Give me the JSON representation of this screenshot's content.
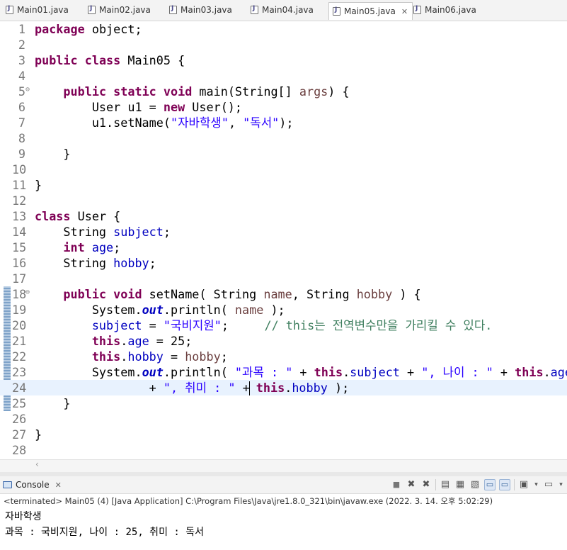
{
  "tabs": [
    {
      "label": "Main01.java",
      "active": false
    },
    {
      "label": "Main02.java",
      "active": false
    },
    {
      "label": "Main03.java",
      "active": false
    },
    {
      "label": "Main04.java",
      "active": false
    },
    {
      "label": "Main05.java",
      "active": true
    },
    {
      "label": "Main06.java",
      "active": false
    }
  ],
  "editor": {
    "line_numbers": [
      "1",
      "2",
      "3",
      "4",
      "5",
      "6",
      "7",
      "8",
      "9",
      "10",
      "11",
      "12",
      "13",
      "14",
      "15",
      "16",
      "17",
      "18",
      "19",
      "20",
      "21",
      "22",
      "23",
      "24",
      "25",
      "26",
      "27",
      "28"
    ],
    "current_line": "24",
    "code": {
      "l1_kw": "package",
      "l1_rest": " object;",
      "l3_kw1": "public",
      "l3_kw2": "class",
      "l3_rest": " Main05 {",
      "l5_ind": "    ",
      "l5_kw1": "public",
      "l5_kw2": "static",
      "l5_kw3": "void",
      "l5_rest": " main(String[] ",
      "l5_var": "args",
      "l5_end": ") {",
      "l6_pre": "        User u1 = ",
      "l6_kw": "new",
      "l6_rest": " User();",
      "l7_pre": "        u1.setName(",
      "l7_s1": "\"자바학생\"",
      "l7_mid": ", ",
      "l7_s2": "\"독서\"",
      "l7_end": ");",
      "l9": "    }",
      "l11": "}",
      "l13_kw": "class",
      "l13_rest": " User {",
      "l14_pre": "    String ",
      "l14_fld": "subject",
      "l14_end": ";",
      "l15_ind": "    ",
      "l15_kw": "int",
      "l15_sp": " ",
      "l15_fld": "age",
      "l15_end": ";",
      "l16_pre": "    String ",
      "l16_fld": "hobby",
      "l16_end": ";",
      "l18_ind": "    ",
      "l18_kw1": "public",
      "l18_kw2": "void",
      "l18_mid": " setName( String ",
      "l18_v1": "name",
      "l18_mid2": ", String ",
      "l18_v2": "hobby",
      "l18_end": " ) {",
      "l19_pre": "        System.",
      "l19_out": "out",
      "l19_mid": ".println( ",
      "l19_var": "name",
      "l19_end": " );",
      "l20_ind": "        ",
      "l20_fld": "subject",
      "l20_eq": " = ",
      "l20_str": "\"국비지원\"",
      "l20_semi": ";     ",
      "l20_cmt": "// this는 전역변수만을 가리킬 수 있다.",
      "l21_ind": "        ",
      "l21_kw": "this",
      "l21_dot": ".",
      "l21_fld": "age",
      "l21_end": " = 25;",
      "l22_ind": "        ",
      "l22_kw": "this",
      "l22_dot": ".",
      "l22_fld": "hobby",
      "l22_eq": " = ",
      "l22_var": "hobby",
      "l22_end": ";",
      "l23_pre": "        System.",
      "l23_out": "out",
      "l23_mid": ".println( ",
      "l23_s1": "\"과목 : \"",
      "l23_p1": " + ",
      "l23_kw1": "this",
      "l23_d1": ".",
      "l23_f1": "subject",
      "l23_p2": " + ",
      "l23_s2": "\", 나이 : \"",
      "l23_p3": " + ",
      "l23_kw2": "this",
      "l23_d2": ".",
      "l23_f2": "age",
      "l24_pre": "                + ",
      "l24_s1": "\", 취미 : \"",
      "l24_p": " +",
      "l24_sp": " ",
      "l24_kw": "this",
      "l24_d": ".",
      "l24_f": "hobby",
      "l24_end": " );",
      "l25": "    }",
      "l27": "}"
    }
  },
  "console": {
    "tab_label": "Console",
    "status": "<terminated> Main05 (4) [Java Application] C:\\Program Files\\Java\\jre1.8.0_321\\bin\\javaw.exe (2022. 3. 14. 오후 5:02:29)",
    "output": [
      "자바학생",
      "과목 : 국비지원, 나이 : 25, 취미 : 독서"
    ]
  },
  "colors": {
    "keyword": "#7f0055",
    "field": "#0000c0",
    "string": "#2a00ff",
    "comment": "#3f7f5f",
    "current_line": "#e8f2fe"
  }
}
